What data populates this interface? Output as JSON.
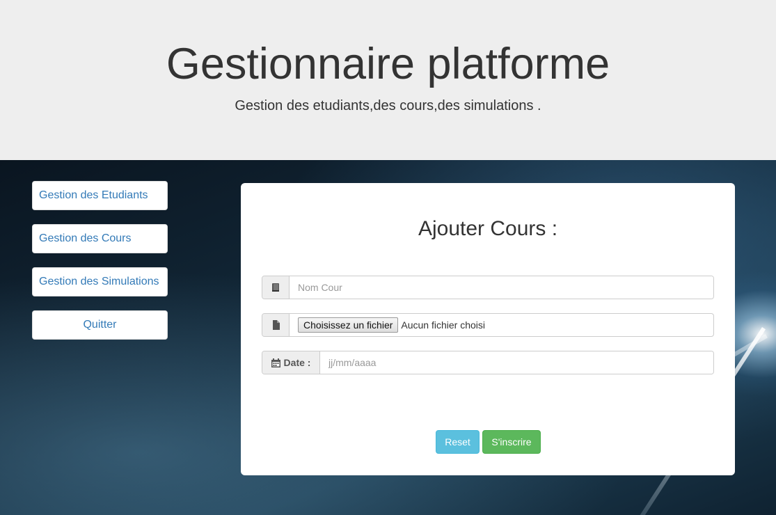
{
  "header": {
    "title": "Gestionnaire platforme",
    "subtitle": "Gestion des etudiants,des cours,des simulations ."
  },
  "sidebar": {
    "items": [
      {
        "label": "Gestion des Etudiants"
      },
      {
        "label": "Gestion des Cours"
      },
      {
        "label": "Gestion des Simulations"
      },
      {
        "label": "Quitter"
      }
    ]
  },
  "form": {
    "title": "Ajouter Cours :",
    "name_field": {
      "placeholder": "Nom Cour",
      "icon": "book-icon"
    },
    "file_field": {
      "button_label": "Choisissez un fichier",
      "status": "Aucun fichier choisi",
      "icon": "file-icon"
    },
    "date_field": {
      "label": "Date :",
      "placeholder": "jj/mm/aaaa",
      "icon": "calendar-icon"
    },
    "reset_label": "Reset",
    "submit_label": "S'inscrire"
  },
  "colors": {
    "link": "#337ab7",
    "reset": "#5bc0de",
    "submit": "#5cb85c",
    "jumbotron": "#eeeeee"
  }
}
